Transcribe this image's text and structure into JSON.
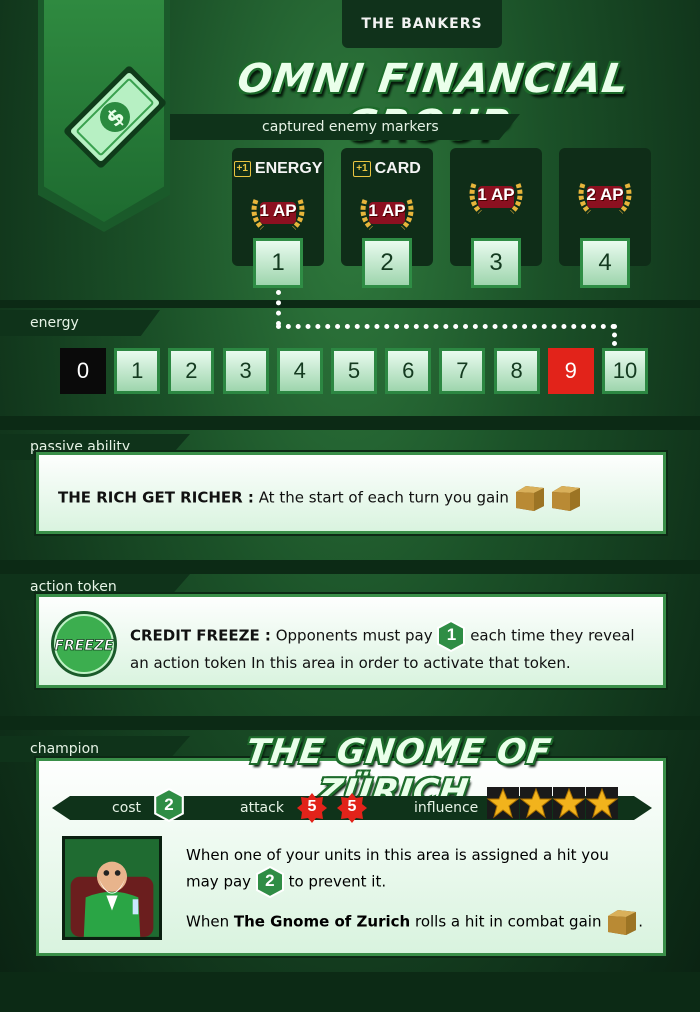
{
  "faction": "THE BANKERS",
  "title": "OMNI FINANCIAL GROUP",
  "captured_label": "captured enemy markers",
  "markers": [
    {
      "plus": "+1",
      "bonus": "ENERGY",
      "ap": "1 AP",
      "number": "1"
    },
    {
      "plus": "+1",
      "bonus": "CARD",
      "ap": "1 AP",
      "number": "2"
    },
    {
      "plus": "",
      "bonus": "",
      "ap": "1 AP",
      "number": "3"
    },
    {
      "plus": "",
      "bonus": "",
      "ap": "2 AP",
      "number": "4"
    }
  ],
  "energy_label": "energy",
  "energy_track": [
    "0",
    "1",
    "2",
    "3",
    "4",
    "5",
    "6",
    "7",
    "8",
    "9",
    "10"
  ],
  "passive": {
    "label": "passive ability",
    "name": "THE RICH GET RICHER :",
    "text": "At the start of each turn you gain"
  },
  "action": {
    "label": "action token",
    "token": "FREEZE",
    "name": "CREDIT FREEZE :",
    "text1": "Opponents must pay",
    "cost": "1",
    "text2": "each time they reveal",
    "text3": "an action token In this area in order to activate that token."
  },
  "champion": {
    "label": "champion",
    "name": "THE GNOME OF ZÜRICH",
    "cost_label": "cost",
    "cost": "2",
    "attack_label": "attack",
    "attack": [
      "5",
      "5"
    ],
    "influence_label": "influence",
    "influence_stars": 4,
    "ability1a": "When one of your units in this area is assigned a hit you",
    "ability1b": "may pay",
    "ability1_cost": "2",
    "ability1c": "to prevent it.",
    "ability2a": "When",
    "ability2_name": "The Gnome of Zurich",
    "ability2b": "rolls a hit in combat gain",
    "ability2c": "."
  },
  "colors": {
    "accent": "#2f8d45",
    "red": "#e2231a",
    "dark": "#0f331a"
  }
}
